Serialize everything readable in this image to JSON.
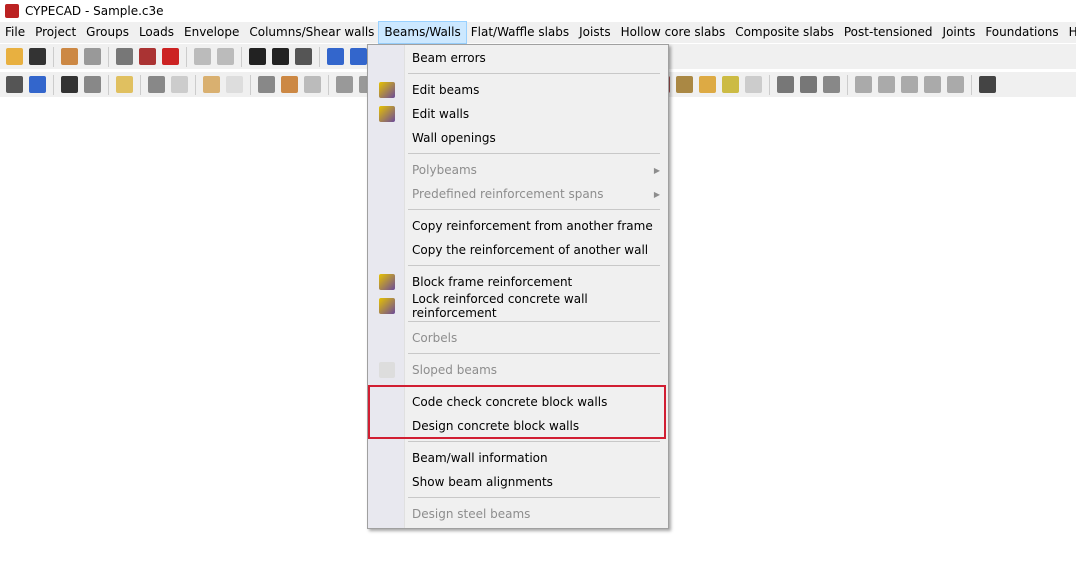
{
  "title": "CYPECAD - Sample.c3e",
  "menubar": [
    "File",
    "Project",
    "Groups",
    "Loads",
    "Envelope",
    "Columns/Shear walls",
    "Beams/Walls",
    "Flat/Waffle slabs",
    "Joists",
    "Hollow core slabs",
    "Composite slabs",
    "Post-tensioned",
    "Joints",
    "Foundations",
    "Help"
  ],
  "menu": {
    "items": [
      {
        "label": "Beam errors"
      },
      {
        "sep": true
      },
      {
        "label": "Edit beams",
        "icon": "edit-beams-icon"
      },
      {
        "label": "Edit walls",
        "icon": "edit-walls-icon"
      },
      {
        "label": "Wall openings"
      },
      {
        "sep": true
      },
      {
        "label": "Polybeams",
        "disabled": true,
        "submenu": true
      },
      {
        "label": "Predefined reinforcement spans",
        "disabled": true,
        "submenu": true
      },
      {
        "sep": true
      },
      {
        "label": "Copy reinforcement from another frame"
      },
      {
        "label": "Copy the reinforcement of another wall"
      },
      {
        "sep": true
      },
      {
        "label": "Block frame reinforcement",
        "icon": "block-frame-icon"
      },
      {
        "label": "Lock reinforced concrete wall reinforcement",
        "icon": "lock-wall-icon"
      },
      {
        "sep": true
      },
      {
        "label": "Corbels",
        "disabled": true
      },
      {
        "sep": true
      },
      {
        "label": "Sloped beams",
        "disabled": true,
        "icon": "sloped-beams-icon"
      },
      {
        "sep": true
      },
      {
        "label": "Code check concrete block walls"
      },
      {
        "label": "Design concrete block walls"
      },
      {
        "sep": true
      },
      {
        "label": "Beam/wall information"
      },
      {
        "label": "Show beam alignments"
      },
      {
        "sep": true
      },
      {
        "label": "Design steel beams",
        "disabled": true
      }
    ]
  },
  "colors": {
    "highlight": "#d11e32"
  }
}
